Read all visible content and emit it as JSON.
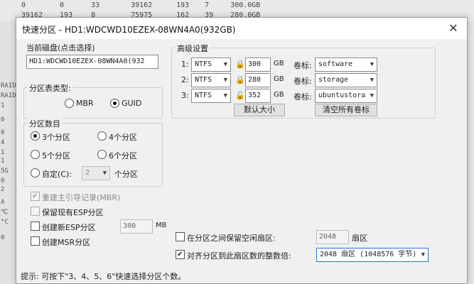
{
  "background": {
    "rows": [
      [
        "0",
        "0",
        "33",
        "39162",
        "193",
        "7",
        "300.0GB"
      ],
      [
        "39162",
        "193",
        "8",
        "75975",
        "162",
        "39",
        "280.0GB"
      ]
    ],
    "left_fragments": [
      "RAID",
      "RAID",
      "1",
      "0",
      "0",
      "4",
      "1",
      "1",
      "5G",
      "0",
      "2",
      "A",
      "℃",
      "°C",
      "0"
    ]
  },
  "dialog": {
    "title": "快速分区 - HD1:WDCWD10EZEX-08WN4A0(932GB)",
    "close_symbol": "✕",
    "current_disk": {
      "label": "当前磁盘(点击选择)",
      "value": "HD1:WDCWD10EZEX-08WN4A0(932"
    },
    "partition_table": {
      "label": "分区表类型:",
      "options": [
        "MBR",
        "GUID"
      ],
      "selected": "GUID"
    },
    "partition_count": {
      "label": "分区数目",
      "options": [
        "3个分区",
        "4个分区",
        "5个分区",
        "6个分区"
      ],
      "custom_label": "自定(C):",
      "custom_value": "2",
      "custom_suffix": "个分区",
      "selected": "3个分区"
    },
    "checks": {
      "rebuild_mbr": "重建主引导记录(MBR)",
      "keep_esp": "保留现有ESP分区",
      "create_esp": "创建新ESP分区",
      "esp_size": "300",
      "esp_unit": "MB",
      "create_msr": "创建MSR分区"
    },
    "advanced": {
      "label": "高级设置",
      "rows": [
        {
          "index": "1:",
          "fs": "NTFS",
          "size": "300",
          "unit": "GB",
          "vol_label_caption": "卷标:",
          "vol": "software",
          "lock": "🔒"
        },
        {
          "index": "2:",
          "fs": "NTFS",
          "size": "280",
          "unit": "GB",
          "vol_label_caption": "卷标:",
          "vol": "storage",
          "lock": "🔒"
        },
        {
          "index": "3:",
          "fs": "NTFS",
          "size": "352",
          "unit": "GB",
          "vol_label_caption": "卷标:",
          "vol": "ubuntustora",
          "lock": "🔓"
        }
      ],
      "default_size_btn": "默认大小",
      "clear_labels_btn": "清空所有卷标"
    },
    "bottom": {
      "keep_free_label": "在分区之间保留空闲扇区:",
      "keep_free_value": "2048",
      "keep_free_unit": "扇区",
      "align_label": "对齐分区到此扇区数的整数倍:",
      "align_value": "2048 扇区 (1048576 字节)"
    },
    "hint": "提示: 可按下\"3、4、5、6\"快速选择分区个数。"
  }
}
